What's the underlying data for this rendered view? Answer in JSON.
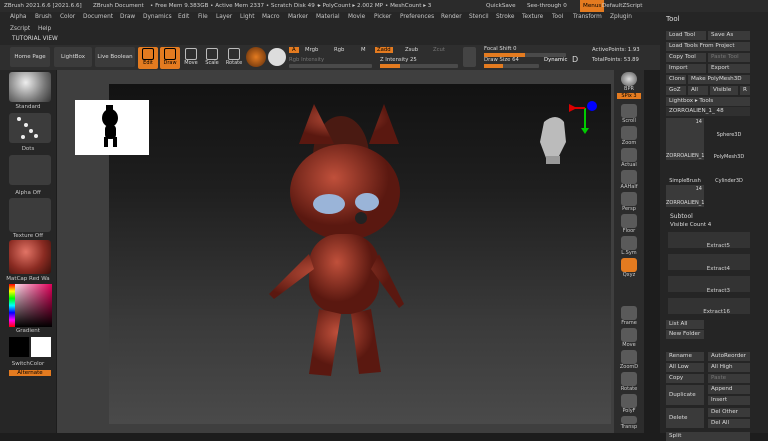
{
  "titlebar": {
    "app": "ZBrush 2021.6.6 [2021.6.6]",
    "doc": "ZBrush Document",
    "mem": "• Free Mem 9.383GB • Active Mem 2337 • Scratch Disk 49 •",
    "poly": "▸ PolyCount ▸ 2.002 MP",
    "mesh": "• MeshCount ▸ 3",
    "quicksave": "QuickSave",
    "seethrough": "See-through  0",
    "menus": "Menus",
    "script": "DefaultZScript"
  },
  "menu": [
    "Alpha",
    "Brush",
    "Color",
    "Document",
    "Draw",
    "Dynamics",
    "Edit",
    "File",
    "Layer",
    "Light",
    "Macro",
    "Marker",
    "Material",
    "Movie",
    "Picker",
    "Preferences",
    "Render",
    "Stencil",
    "Stroke",
    "Texture",
    "Tool",
    "Transform",
    "Zplugin"
  ],
  "menu2": [
    "Zscript",
    "Help"
  ],
  "tutorial": "TUTORIAL VIEW",
  "toolbar": {
    "home": "Home Page",
    "lightbox": "LightBox",
    "liveboolean": "Live Boolean",
    "edit": "Edit",
    "draw": "Draw",
    "move": "Move",
    "scale": "Scale",
    "rotate": "Rotate",
    "a": "A",
    "mrgb": "Mrgb",
    "rgb": "Rgb",
    "m": "M",
    "zadd": "Zadd",
    "zsub": "Zsub",
    "zcut": "Zcut",
    "rgbint": "Rgb Intensity",
    "zint": "Z Intensity  25",
    "focal": "Focal Shift  0",
    "drawsize": "Draw Size  64",
    "dynamic": "Dynamic",
    "activepoints": "ActivePoints: 1.93",
    "totalpoints": "TotalPoints: 53.89",
    "d": "D"
  },
  "left": {
    "standard": "Standard",
    "dots": "Dots",
    "alpha": "Alpha Off",
    "texture": "Texture Off",
    "matcap": "MatCap Red Wa",
    "gradient": "Gradient",
    "switchcolor": "SwitchColor",
    "alternate": "Alternate"
  },
  "shelf": [
    "BPR",
    "SPix  3",
    "Scroll",
    "Zoom",
    "Actual",
    "AAHalf",
    "Persp",
    "Floor",
    "L.Sym",
    "Qxyz",
    "Frame",
    "Move",
    "ZoomD",
    "Rotate",
    "PolyF",
    "Transp"
  ],
  "tool": {
    "header": "Tool",
    "load": "Load Tool",
    "saveas": "Save As",
    "loadproj": "Load Tools From Project",
    "copy": "Copy Tool",
    "paste": "Paste Tool",
    "import": "Import",
    "export": "Export",
    "clone": "Clone",
    "makepm": "Make PolyMesh3D",
    "goz": "GoZ",
    "all": "All",
    "visible": "Visible",
    "r": "R",
    "lightbox": "Lightbox ▸ Tools",
    "current": "ZORROALIEN_1_ 48",
    "thumbs": [
      {
        "n": "ZORROALIEN_1",
        "c": "14"
      },
      {
        "n": "Sphere3D",
        "c": ""
      },
      {
        "n": "SimpleBrush",
        "c": ""
      },
      {
        "n": "PolyMesh3D",
        "c": ""
      },
      {
        "n": "ZORROALIEN_1",
        "c": "14"
      },
      {
        "n": "Cylinder3D",
        "c": ""
      }
    ],
    "subtool": "Subtool",
    "viscount": "Visible Count  4",
    "subs": [
      "Extract5",
      "Extract4",
      "Extract3",
      "Extract16"
    ],
    "listall": "List All",
    "newfolder": "New Folder",
    "rename": "Rename",
    "autoreorder": "AutoReorder",
    "alllow": "All Low",
    "allhigh": "All High",
    "copy2": "Copy",
    "paste2": "Paste",
    "duplicate": "Duplicate",
    "append": "Append",
    "insert": "Insert",
    "delete": "Delete",
    "delother": "Del Other",
    "delall": "Del All",
    "split": "Split"
  }
}
